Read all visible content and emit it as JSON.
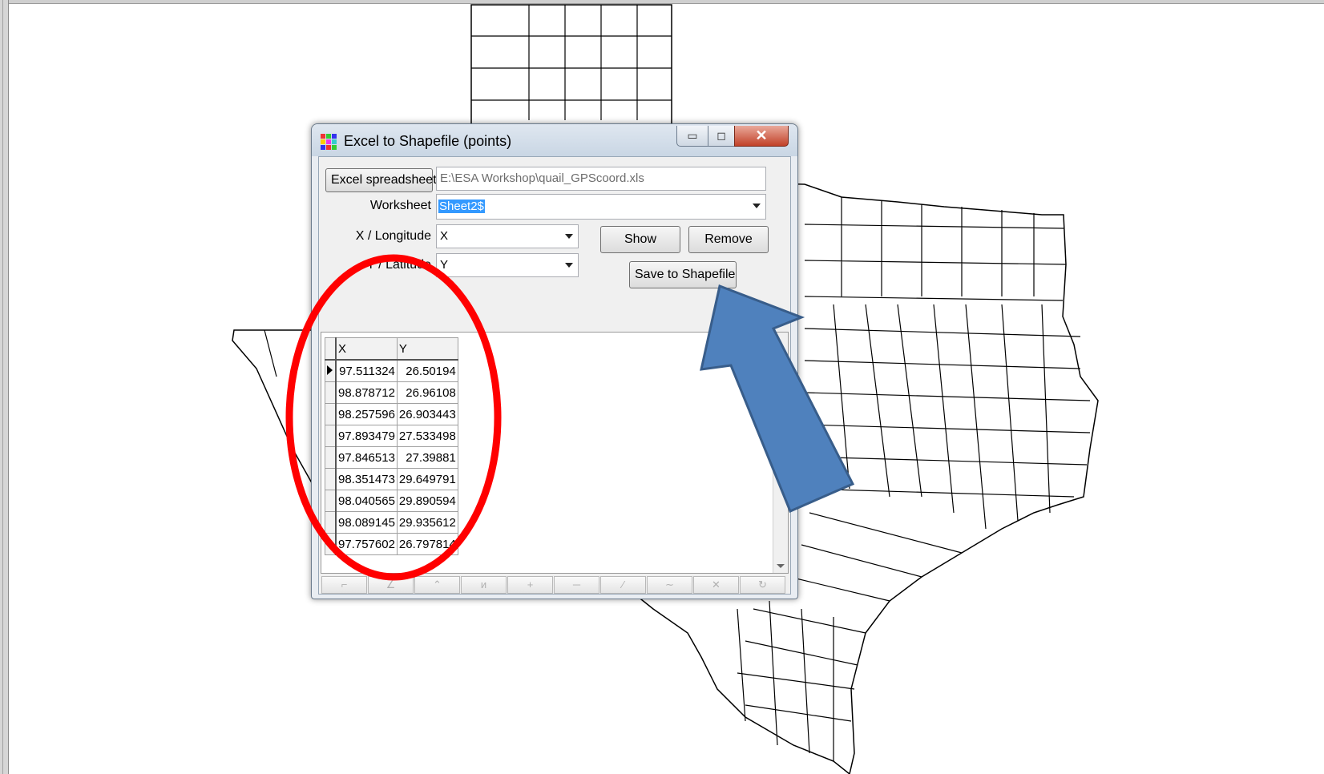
{
  "window": {
    "title": "Excel to Shapefile (points)",
    "minimize_glyph": "▭",
    "maximize_glyph": "◻",
    "close_glyph": "✕"
  },
  "form": {
    "excel_button": "Excel spreadsheet",
    "excel_path": "E:\\ESA Workshop\\quail_GPScoord.xls",
    "worksheet_label": "Worksheet",
    "worksheet_value": "Sheet2$",
    "x_label": "X / Longitude",
    "x_value": "X",
    "y_label": "Y / Latitude",
    "y_value": "Y",
    "show_button": "Show",
    "remove_button": "Remove",
    "save_button": "Save to Shapefile"
  },
  "grid": {
    "columns": [
      "X",
      "Y"
    ],
    "rows": [
      {
        "x": "97.511324",
        "y": "26.50194"
      },
      {
        "x": "98.878712",
        "y": "26.96108"
      },
      {
        "x": "98.257596",
        "y": "26.903443"
      },
      {
        "x": "97.893479",
        "y": "27.533498"
      },
      {
        "x": "97.846513",
        "y": "27.39881"
      },
      {
        "x": "98.351473",
        "y": "29.649791"
      },
      {
        "x": "98.040565",
        "y": "29.890594"
      },
      {
        "x": "98.089145",
        "y": "29.935612"
      },
      {
        "x": "97.757602",
        "y": "26.797814"
      }
    ]
  },
  "toolbar": {
    "icons": [
      "line-start-icon",
      "line-angle-icon",
      "line-peak-icon",
      "polyline-icon",
      "crosshair-icon",
      "hline-icon",
      "diagonal-icon",
      "curve-icon",
      "cross-icon",
      "rotate-icon"
    ],
    "glyphs": [
      "⌐",
      "∠",
      "⌃",
      "ᴎ",
      "+",
      "─",
      "⁄",
      "∼",
      "✕",
      "↻"
    ]
  },
  "annotations": {
    "circle_color": "#ff0000",
    "arrow_color": "#4f81bd",
    "arrow_outline_color": "#385d8a"
  },
  "colors": {
    "map_fill": "#ffffff",
    "map_line": "#000000",
    "selection": "#3399ff"
  }
}
